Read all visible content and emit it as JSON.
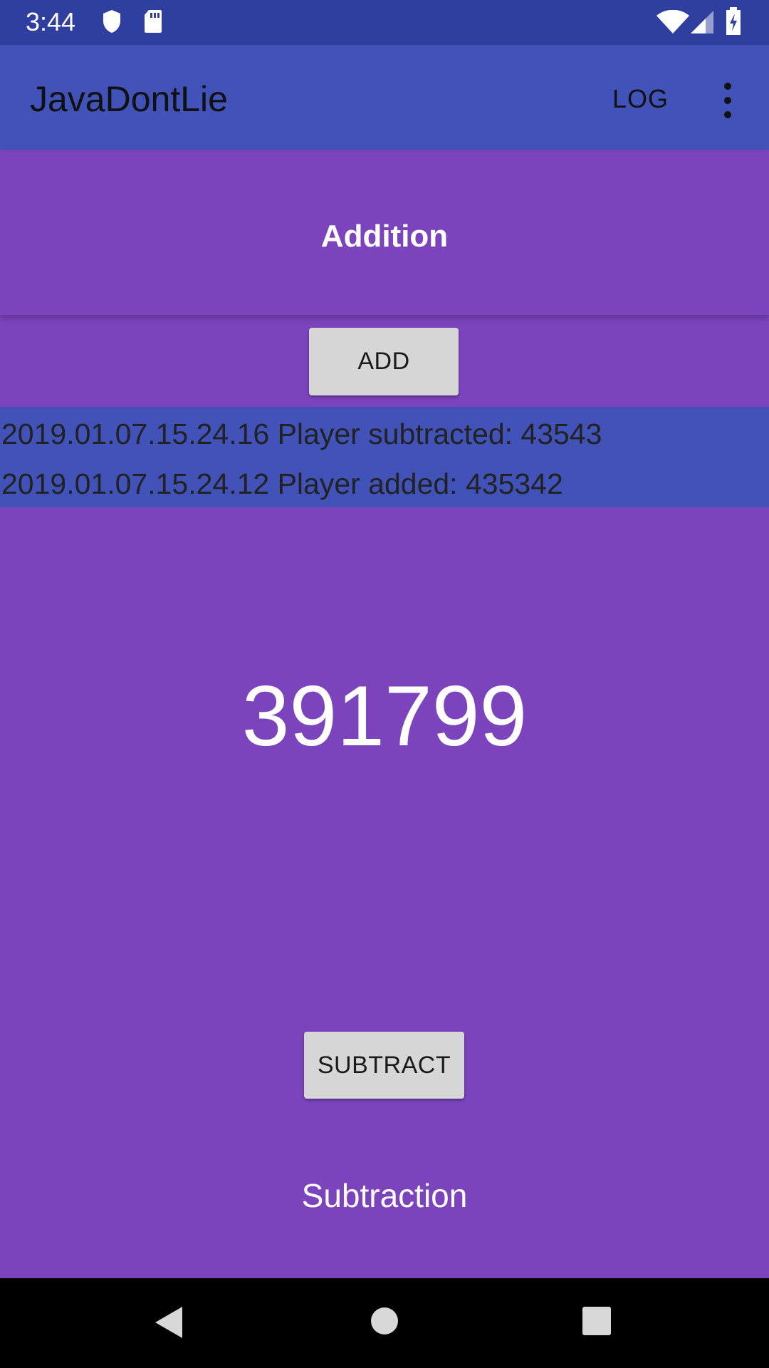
{
  "status_bar": {
    "time": "3:44",
    "left_icons": [
      "shield-icon",
      "sd-card-icon"
    ],
    "right_icons": [
      "wifi-icon",
      "cell-signal-icon",
      "battery-charging-icon"
    ]
  },
  "app_bar": {
    "title": "JavaDontLie",
    "log_action": "LOG",
    "overflow_icon": "more-vert-icon"
  },
  "addition": {
    "title": "Addition",
    "button_label": "ADD"
  },
  "log": {
    "entries": [
      "2019.01.07.15.24.16 Player subtracted: 43543",
      "2019.01.07.15.24.12 Player added: 435342"
    ]
  },
  "counter": {
    "value": "391799"
  },
  "subtraction": {
    "button_label": "SUBTRACT",
    "title": "Subtraction"
  },
  "nav_bar": {
    "icons": [
      "back-icon",
      "home-icon",
      "recents-icon"
    ]
  },
  "colors": {
    "status_bar": "#2f3fa0",
    "app_bar": "#4152b8",
    "background": "#7b44bd",
    "log_panel": "#4152b8",
    "button": "#d6d6d6"
  }
}
